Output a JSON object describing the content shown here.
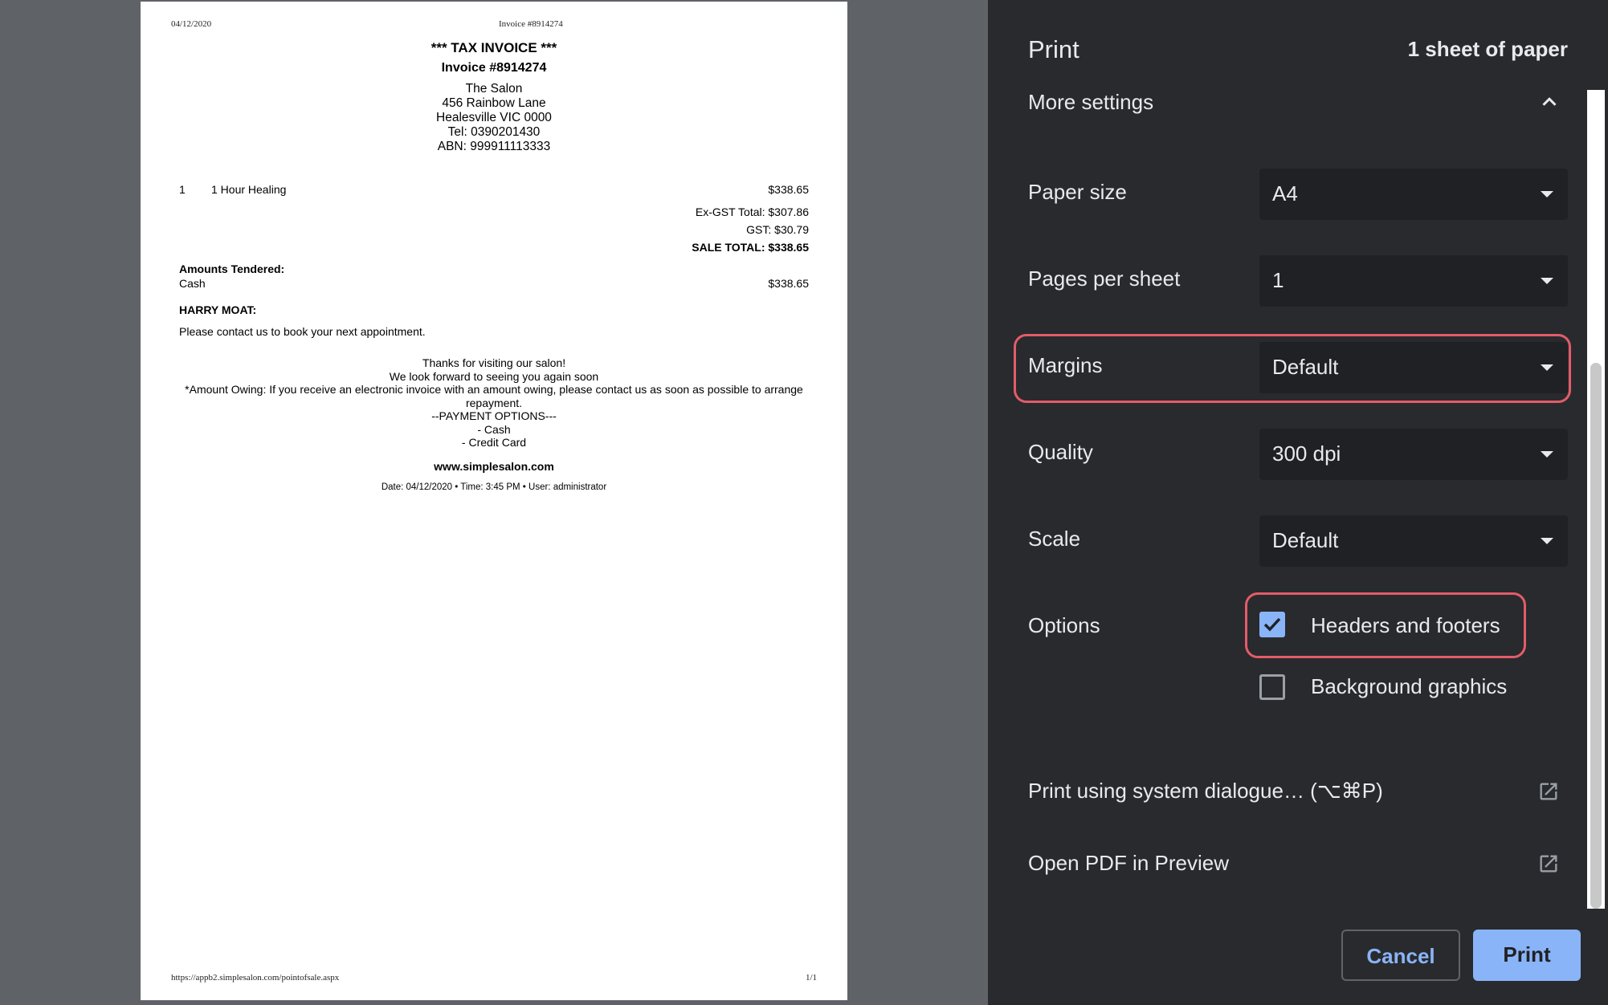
{
  "document": {
    "header_date": "04/12/2020",
    "header_title": "Invoice #8914274",
    "title": "*** TAX INVOICE ***",
    "invoice_number": "Invoice #8914274",
    "address": [
      "The Salon",
      "456 Rainbow Lane",
      "Healesville VIC 0000",
      "Tel: 0390201430",
      "ABN: 999911113333"
    ],
    "line_item": {
      "qty": "1",
      "description": "1 Hour Healing",
      "amount": "$338.65"
    },
    "ex_gst_total": "Ex-GST Total: $307.86",
    "gst": "GST: $30.79",
    "sale_total": "SALE TOTAL: $338.65",
    "amounts_tendered_label": "Amounts Tendered:",
    "tender_method": "Cash",
    "tender_amount": "$338.65",
    "client_name": "HARRY MOAT:",
    "contact_message": "Please contact us to book your next appointment.",
    "thanks_lines": [
      "Thanks for visiting our salon!",
      "We look forward to seeing you again soon",
      "*Amount Owing: If you receive an electronic invoice with an amount owing, please contact us as soon as possible to arrange repayment.",
      "--PAYMENT OPTIONS---",
      "- Cash",
      "- Credit Card"
    ],
    "website": "www.simplesalon.com",
    "stamp": "Date: 04/12/2020 • Time: 3:45 PM • User: administrator",
    "footer_url": "https://appb2.simplesalon.com/pointofsale.aspx",
    "footer_page": "1/1"
  },
  "panel": {
    "title": "Print",
    "sheets": "1 sheet of paper",
    "more_settings": "More settings",
    "paper_size": {
      "label": "Paper size",
      "value": "A4"
    },
    "pages_per_sheet": {
      "label": "Pages per sheet",
      "value": "1"
    },
    "margins": {
      "label": "Margins",
      "value": "Default"
    },
    "quality": {
      "label": "Quality",
      "value": "300 dpi"
    },
    "scale": {
      "label": "Scale",
      "value": "Default"
    },
    "options_label": "Options",
    "headers_footers": {
      "label": "Headers and footers",
      "checked": true
    },
    "background_graphics": {
      "label": "Background graphics",
      "checked": false
    },
    "system_dialog": "Print using system dialogue… (⌥⌘P)",
    "open_pdf": "Open PDF in Preview",
    "cancel": "Cancel",
    "print": "Print"
  },
  "colors": {
    "accent": "#8ab4f8",
    "highlight": "#e35c6a",
    "panel_bg": "#292a2d",
    "preview_bg": "#5f6368"
  }
}
